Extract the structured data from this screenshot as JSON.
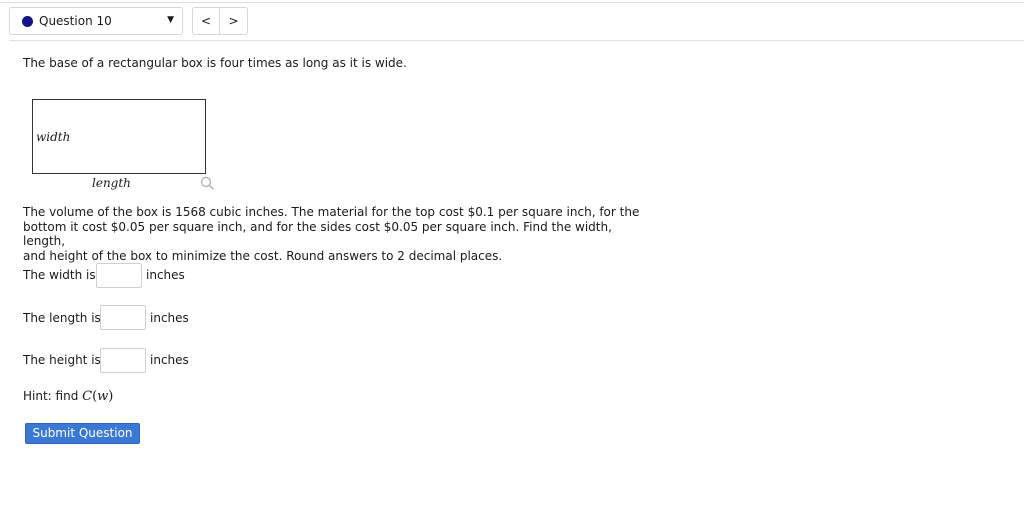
{
  "header": {
    "question_label": "Question 10",
    "dropdown_caret": "▼",
    "prev_label": "<",
    "next_label": ">",
    "status_color": "#13138a"
  },
  "problem": {
    "intro": "The base of a rectangular box is four times as long as it is wide.",
    "figure": {
      "width_label": "width",
      "length_label": "length",
      "zoom_icon": "magnifier-icon"
    },
    "paragraph_lines": [
      "The volume of the box is 1568 cubic inches. The material for the top cost $0.1 per square inch, for the",
      "bottom it cost $0.05 per square inch, and for the sides cost $0.05 per square inch. Find the width, length,",
      "and height of the box to minimize the cost. Round answers to 2 decimal places."
    ]
  },
  "answers": {
    "width": {
      "label": "The width is",
      "value": "",
      "unit": "inches"
    },
    "length": {
      "label": "The length is",
      "value": "",
      "unit": "inches"
    },
    "height": {
      "label": "The height is",
      "value": "",
      "unit": "inches"
    }
  },
  "hint": {
    "prefix": "Hint: find ",
    "func": "C",
    "arg": "w"
  },
  "submit_label": "Submit Question",
  "colors": {
    "submit_bg": "#3b78d4",
    "border": "#d7d7d7"
  }
}
